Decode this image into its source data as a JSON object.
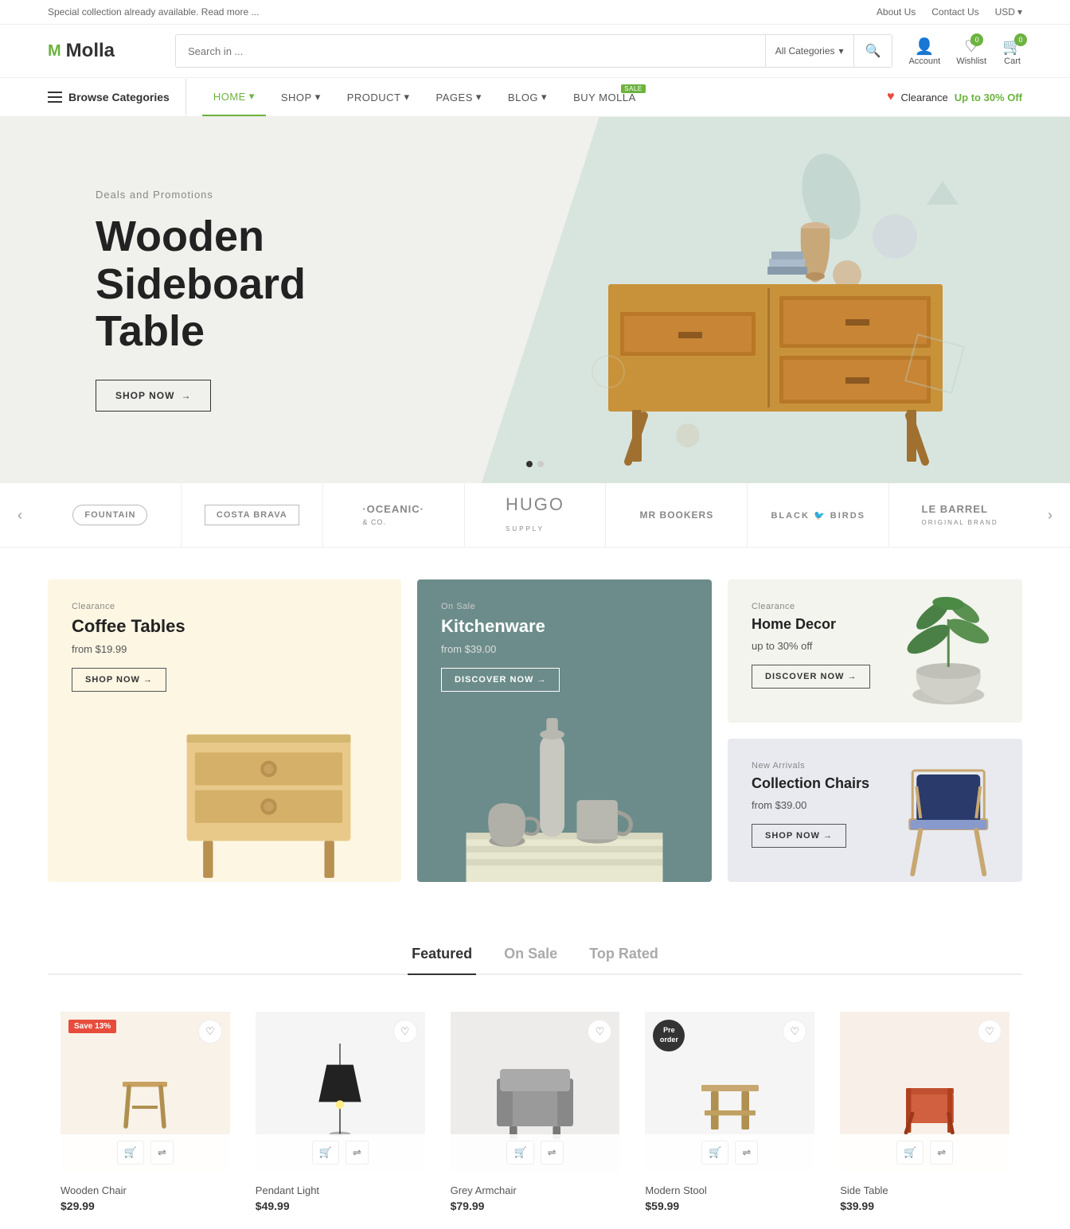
{
  "topbar": {
    "announcement": "Special collection already available. Read more ...",
    "links": [
      "About Us",
      "Contact Us"
    ],
    "currency": "USD",
    "currency_arrow": "▾"
  },
  "header": {
    "logo_text": "Molla",
    "search_placeholder": "Search in ...",
    "search_categories_label": "All Categories",
    "account_label": "Account",
    "wishlist_label": "Wishlist",
    "cart_label": "Cart",
    "wishlist_count": "0",
    "cart_count": "0"
  },
  "nav": {
    "browse_label": "Browse Categories",
    "links": [
      {
        "label": "HOME",
        "active": true,
        "has_dropdown": true,
        "sale_badge": ""
      },
      {
        "label": "SHOP",
        "active": false,
        "has_dropdown": true,
        "sale_badge": ""
      },
      {
        "label": "PRODUCT",
        "active": false,
        "has_dropdown": true,
        "sale_badge": ""
      },
      {
        "label": "PAGES",
        "active": false,
        "has_dropdown": true,
        "sale_badge": ""
      },
      {
        "label": "BLOG",
        "active": false,
        "has_dropdown": true,
        "sale_badge": ""
      },
      {
        "label": "BUY MOLLA",
        "active": false,
        "has_dropdown": false,
        "sale_badge": "SALE"
      }
    ],
    "clearance_label": "Clearance",
    "clearance_offer": "Up to 30% Off"
  },
  "hero": {
    "subtitle": "Deals and Promotions",
    "title_line1": "Wooden",
    "title_line2": "Sideboard Table",
    "cta_label": "SHOP NOW",
    "cta_arrow": "→",
    "dots": [
      1,
      2
    ]
  },
  "brands": [
    {
      "name": "FOUNTAIN"
    },
    {
      "name": "COSTA BRAVA"
    },
    {
      "name": "·OCEANIC·"
    },
    {
      "name": "HuGo"
    },
    {
      "name": "MR BOOKERS"
    },
    {
      "name": "BLACK BIRDS"
    },
    {
      "name": "LE BARREL"
    }
  ],
  "banners": {
    "left": {
      "tag": "Clearance",
      "title": "Coffee Tables",
      "price": "from $19.99",
      "cta": "SHOP NOW →"
    },
    "middle": {
      "tag": "On Sale",
      "title": "Kitchenware",
      "price": "from $39.00",
      "cta": "Discover Now →"
    },
    "right_top": {
      "tag": "Clearance",
      "title": "Home Decor",
      "price": "up to 30% off",
      "cta": "Discover Now →"
    },
    "right_bottom": {
      "tag": "New Arrivals",
      "title": "Collection Chairs",
      "price": "from $39.00",
      "cta": "Shop Now →"
    }
  },
  "product_tabs": {
    "tabs": [
      "Featured",
      "On Sale",
      "Top Rated"
    ],
    "active": 0
  },
  "products": [
    {
      "name": "Wooden Chair",
      "price": "$29.99",
      "old_price": "",
      "badge": "Save 13%",
      "badge_type": "sale"
    },
    {
      "name": "Pendant Light",
      "price": "$49.99",
      "old_price": "",
      "badge": "",
      "badge_type": ""
    },
    {
      "name": "Grey Armchair",
      "price": "$79.99",
      "old_price": "",
      "badge": "",
      "badge_type": ""
    },
    {
      "name": "Modern Stool",
      "price": "$59.99",
      "old_price": "",
      "badge": "Pre order",
      "badge_type": "preorder"
    },
    {
      "name": "Side Table",
      "price": "$39.99",
      "old_price": "",
      "badge": "",
      "badge_type": ""
    }
  ]
}
